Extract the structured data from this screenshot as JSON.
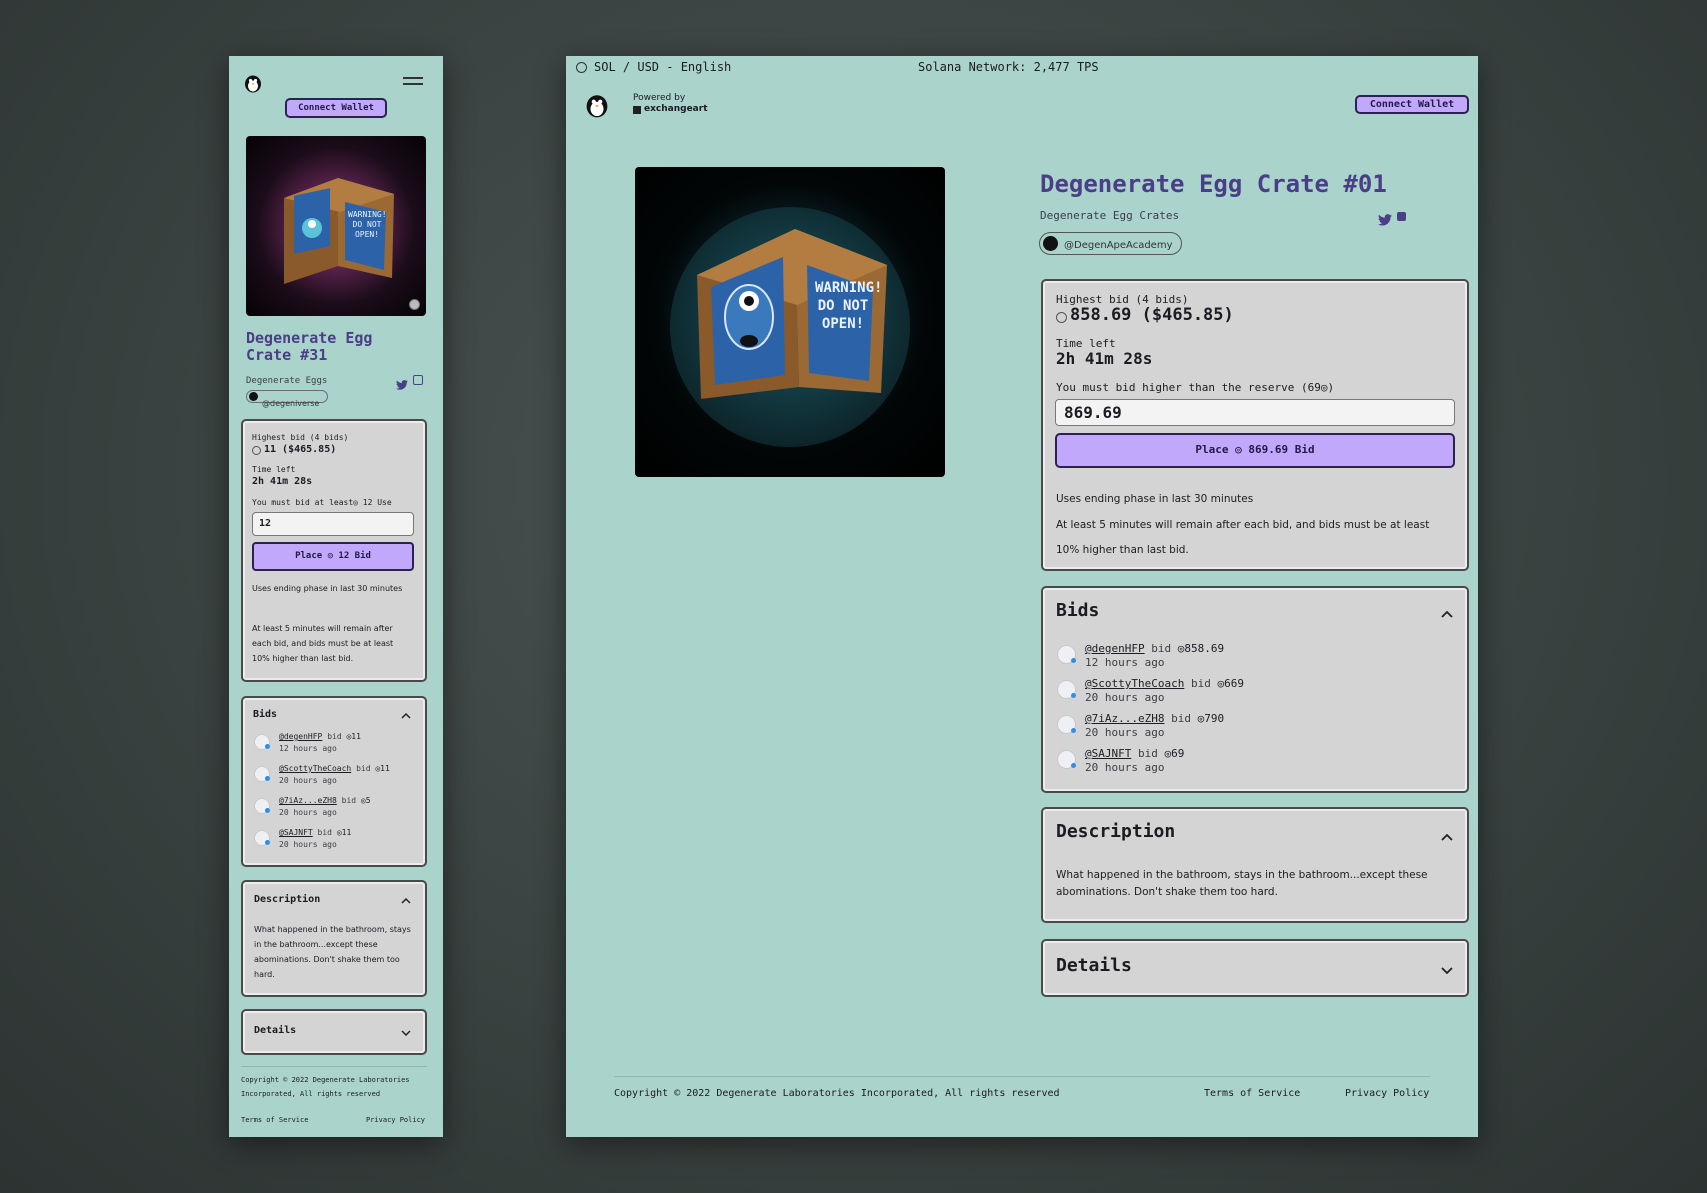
{
  "desktop": {
    "topbar": {
      "locale": "SOL / USD - English",
      "network": "Solana Network: 2,477 TPS"
    },
    "header": {
      "powered_by": "Powered by",
      "brand": "exchangeart",
      "connect_wallet": "Connect Wallet"
    },
    "item": {
      "title": "Degenerate Egg Crate #01",
      "collection": "Degenerate Egg Crates",
      "creator": "@DegenApeAcademy",
      "crate_text": "WARNING! DO NOT OPEN!"
    },
    "auction": {
      "highest_bid_label": "Highest bid (4 bids)",
      "highest_bid_value": "858.69 ($465.85)",
      "time_left_label": "Time left",
      "time_left_value": "2h 41m 28s",
      "reserve_note": "You must bid higher than the reserve (69◎)",
      "bid_input_value": "869.69",
      "place_bid": "Place ◎ 869.69 Bid",
      "note1": "Uses ending phase in last 30 minutes",
      "note2": "At least 5 minutes will remain after each bid, and bids must be at least 10% higher than last bid."
    },
    "bids": {
      "title": "Bids",
      "rows": [
        {
          "user": "@degenHFP",
          "bid_word": "bid",
          "amount": "◎858.69",
          "time": "12 hours ago"
        },
        {
          "user": "@ScottyTheCoach",
          "bid_word": "bid",
          "amount": "◎669",
          "time": "20 hours ago"
        },
        {
          "user": "@7iAz...eZH8",
          "bid_word": "bid",
          "amount": "◎790",
          "time": "20 hours ago"
        },
        {
          "user": "@SAJNFT",
          "bid_word": "bid",
          "amount": "◎69",
          "time": "20 hours ago"
        }
      ]
    },
    "description": {
      "title": "Description",
      "text": "What happened in the bathroom, stays in the bathroom...except these abominations. Don't shake them too hard."
    },
    "details": {
      "title": "Details"
    },
    "footer": {
      "copyright": "Copyright © 2022 Degenerate Laboratories Incorporated, All rights reserved",
      "terms": "Terms of Service",
      "privacy": "Privacy Policy"
    }
  },
  "mobile": {
    "connect_wallet": "Connect Wallet",
    "item": {
      "title": "Degenerate Egg Crate #31",
      "collection": "Degenerate Eggs",
      "creator": "@degeniverse",
      "crate_text": "WARNING! DO NOT OPEN!"
    },
    "auction": {
      "highest_bid_label": "Highest bid (4 bids)",
      "highest_bid_value": "11 ($465.85)",
      "time_left_label": "Time left",
      "time_left_value": "2h 41m 28s",
      "min_note": "You must bid at least◎ 12 Use",
      "bid_input_value": "12",
      "place_bid": "Place ◎ 12 Bid",
      "note1": "Uses ending phase in last 30 minutes",
      "note2": "At least 5 minutes will remain after each bid, and bids must be at least 10% higher than last bid."
    },
    "bids": {
      "title": "Bids",
      "rows": [
        {
          "user": "@degenHFP",
          "bid_word": "bid",
          "amount": "◎11",
          "time": "12 hours ago"
        },
        {
          "user": "@ScottyTheCoach",
          "bid_word": "bid",
          "amount": "◎11",
          "time": "20 hours ago"
        },
        {
          "user": "@7iAz...eZH8",
          "bid_word": "bid",
          "amount": "◎5",
          "time": "20 hours ago"
        },
        {
          "user": "@SAJNFT",
          "bid_word": "bid",
          "amount": "◎11",
          "time": "20 hours ago"
        }
      ]
    },
    "description": {
      "title": "Description",
      "text": "What happened in the bathroom, stays in the bathroom...except these abominations. Don't shake them too hard."
    },
    "details": {
      "title": "Details"
    },
    "footer": {
      "copyright": "Copyright © 2022 Degenerate Laboratories Incorporated, All rights reserved",
      "terms": "Terms of Service",
      "privacy": "Privacy Policy"
    }
  },
  "colors": {
    "page_bg": "#a9d3cb",
    "accent_purple": "#c2a8fb",
    "title_purple": "#4a3f86",
    "card_bg": "#d4d4d4"
  },
  "icons": [
    "penguin-logo-icon",
    "hamburger-menu-icon",
    "globe-icon",
    "twitter-icon",
    "copy-icon",
    "sol-icon",
    "chevron-up-icon",
    "chevron-down-icon",
    "user-avatar-icon",
    "exchange-art-logo-icon"
  ]
}
